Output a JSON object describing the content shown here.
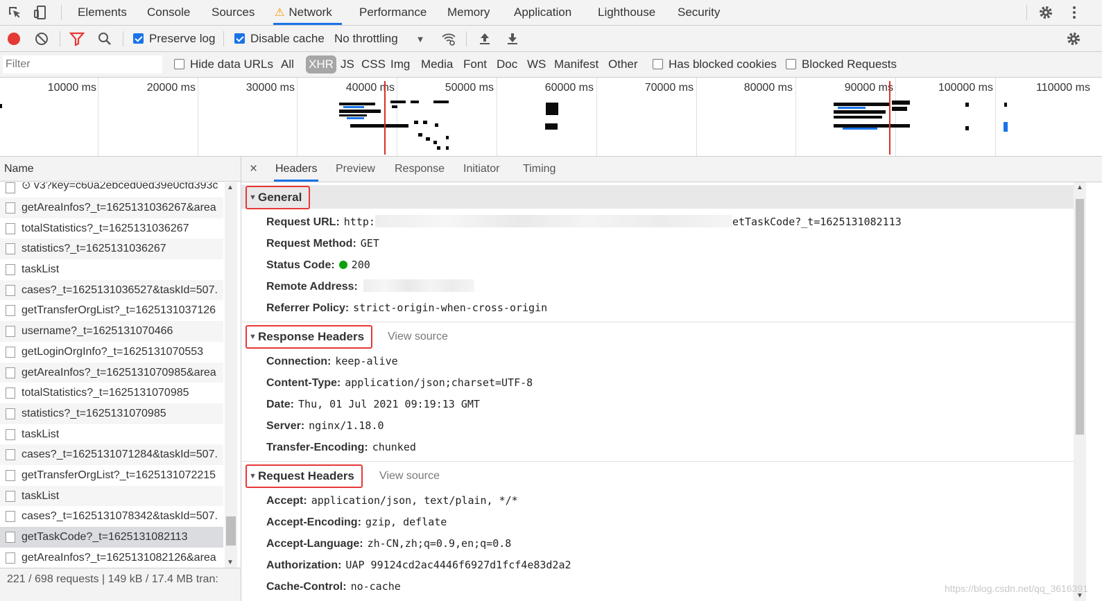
{
  "tabbar": {
    "tabs": [
      "Elements",
      "Console",
      "Sources",
      "Network",
      "Performance",
      "Memory",
      "Application",
      "Lighthouse",
      "Security"
    ],
    "active": "Network"
  },
  "toolbar": {
    "preserve_log": "Preserve log",
    "disable_cache": "Disable cache",
    "throttling": "No throttling"
  },
  "filterbar": {
    "placeholder": "Filter",
    "hide_data_urls": "Hide data URLs",
    "types": [
      "All",
      "XHR",
      "JS",
      "CSS",
      "Img",
      "Media",
      "Font",
      "Doc",
      "WS",
      "Manifest",
      "Other"
    ],
    "selected_type": "XHR",
    "has_blocked_cookies": "Has blocked cookies",
    "blocked_requests": "Blocked Requests"
  },
  "overview": {
    "ticks": [
      "10000 ms",
      "20000 ms",
      "30000 ms",
      "40000 ms",
      "50000 ms",
      "60000 ms",
      "70000 ms",
      "80000 ms",
      "90000 ms",
      "100000 ms",
      "110000 ms"
    ]
  },
  "requests": {
    "header": "Name",
    "items": [
      "⊙ v3?key=c60a2ebced0ed39e0cfd393c",
      "getAreaInfos?_t=1625131036267&area",
      "totalStatistics?_t=1625131036267",
      "statistics?_t=1625131036267",
      "taskList",
      "cases?_t=1625131036527&taskId=507.",
      "getTransferOrgList?_t=1625131037126",
      "username?_t=1625131070466",
      "getLoginOrgInfo?_t=1625131070553",
      "getAreaInfos?_t=1625131070985&area",
      "totalStatistics?_t=1625131070985",
      "statistics?_t=1625131070985",
      "taskList",
      "cases?_t=1625131071284&taskId=507.",
      "getTransferOrgList?_t=1625131072215",
      "taskList",
      "cases?_t=1625131078342&taskId=507.",
      "getTaskCode?_t=1625131082113",
      "getAreaInfos?_t=1625131082126&area"
    ],
    "selected": "getTaskCode?_t=1625131082113",
    "status": "221 / 698 requests  |  149 kB / 17.4 MB tran:"
  },
  "detail": {
    "close": "×",
    "tabs": [
      "Headers",
      "Preview",
      "Response",
      "Initiator",
      "Timing"
    ],
    "active_tab": "Headers",
    "view_source": "View source",
    "general": {
      "title": "General",
      "request_url_key": "Request URL:",
      "request_url_prefix": "http:",
      "request_url_suffix": "etTaskCode?_t=1625131082113",
      "request_method_key": "Request Method:",
      "request_method": "GET",
      "status_code_key": "Status Code:",
      "status_code": "200",
      "remote_address_key": "Remote Address:",
      "referrer_policy_key": "Referrer Policy:",
      "referrer_policy": "strict-origin-when-cross-origin"
    },
    "response_headers": {
      "title": "Response Headers",
      "items": [
        {
          "k": "Connection:",
          "v": "keep-alive"
        },
        {
          "k": "Content-Type:",
          "v": "application/json;charset=UTF-8"
        },
        {
          "k": "Date:",
          "v": "Thu, 01 Jul 2021 09:19:13 GMT"
        },
        {
          "k": "Server:",
          "v": "nginx/1.18.0"
        },
        {
          "k": "Transfer-Encoding:",
          "v": "chunked"
        }
      ]
    },
    "request_headers": {
      "title": "Request Headers",
      "items": [
        {
          "k": "Accept:",
          "v": "application/json, text/plain, */*"
        },
        {
          "k": "Accept-Encoding:",
          "v": "gzip, deflate"
        },
        {
          "k": "Accept-Language:",
          "v": "zh-CN,zh;q=0.9,en;q=0.8"
        },
        {
          "k": "Authorization:",
          "v": "UAP 99124cd2ac4446f6927d1fcf4e83d2a2"
        },
        {
          "k": "Cache-Control:",
          "v": "no-cache"
        }
      ]
    }
  },
  "watermark": "https://blog.csdn.net/qq_3616391",
  "colors": {
    "accent": "#1a73e8",
    "record": "#e53935",
    "highlight_box": "#e53935",
    "status_ok": "#0ca10c",
    "warning": "#f29900"
  }
}
